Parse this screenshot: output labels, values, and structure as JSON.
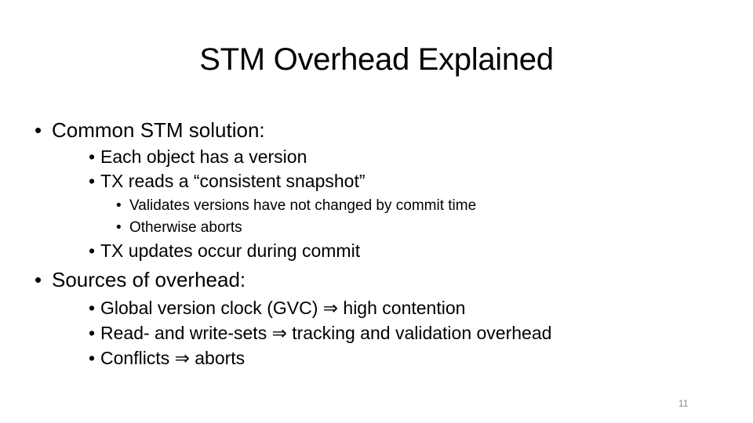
{
  "slide": {
    "title": "STM Overhead Explained",
    "page_number": "11",
    "bullet_glyph": "•",
    "items": [
      {
        "level": 1,
        "text": "Common STM solution:"
      },
      {
        "level": 2,
        "text": "Each object has a version"
      },
      {
        "level": 2,
        "text": "TX reads a “consistent snapshot”"
      },
      {
        "level": 3,
        "text": "Validates versions have not changed by commit time"
      },
      {
        "level": 3,
        "text": "Otherwise aborts"
      },
      {
        "level": 2,
        "text": "TX updates occur during commit"
      },
      {
        "level": 1,
        "text": "Sources of overhead:"
      },
      {
        "level": 2,
        "text": "Global version clock (GVC) ⇒ high contention"
      },
      {
        "level": 2,
        "text": "Read- and write-sets ⇒ tracking and validation overhead"
      },
      {
        "level": 2,
        "text": "Conflicts ⇒ aborts"
      }
    ]
  }
}
